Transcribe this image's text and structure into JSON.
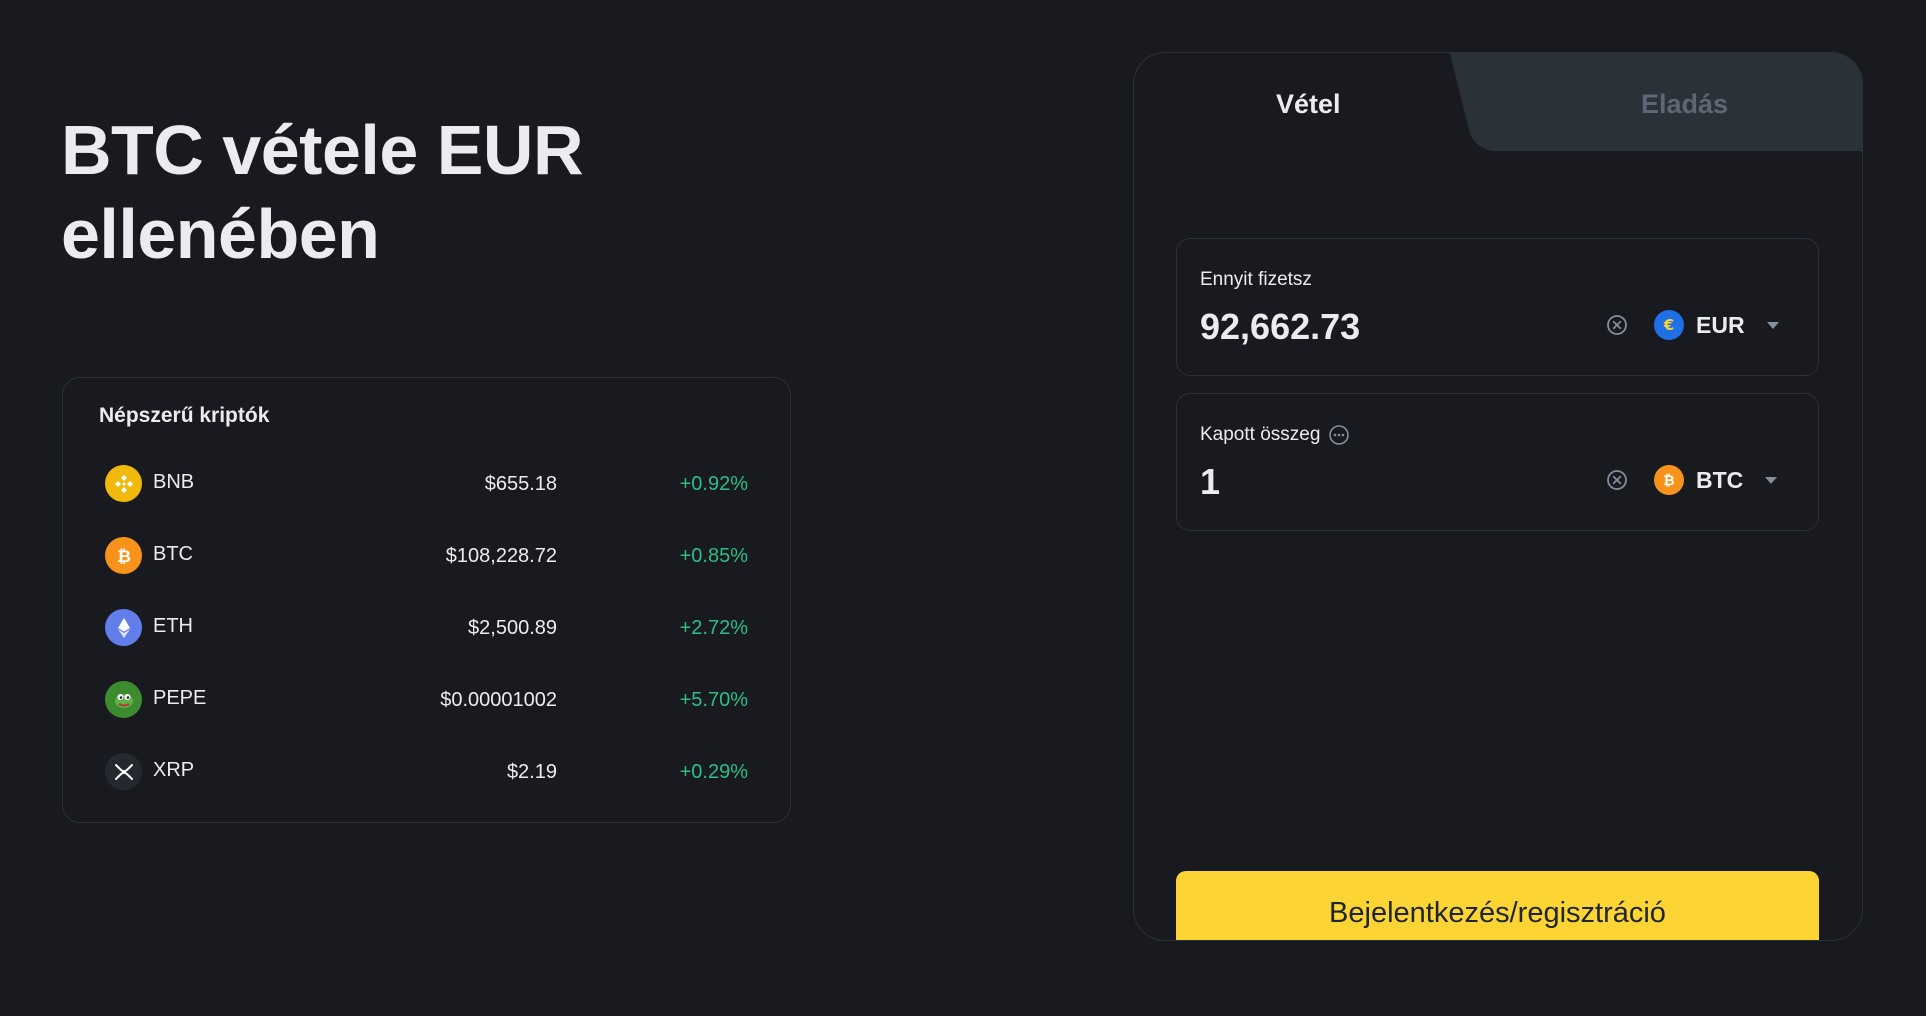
{
  "hero": {
    "title_line1": "BTC vétele EUR",
    "title_line2": "ellenében"
  },
  "popular": {
    "title": "Népszerű kriptók",
    "coins": [
      {
        "symbol": "BNB",
        "price": "$655.18",
        "change": "+0.92%",
        "icon": "bnb-icon",
        "color": "#f0b90b"
      },
      {
        "symbol": "BTC",
        "price": "$108,228.72",
        "change": "+0.85%",
        "icon": "btc-icon",
        "color": "#f7931a"
      },
      {
        "symbol": "ETH",
        "price": "$2,500.89",
        "change": "+2.72%",
        "icon": "eth-icon",
        "color": "#627eea"
      },
      {
        "symbol": "PEPE",
        "price": "$0.00001002",
        "change": "+5.70%",
        "icon": "pepe-icon",
        "color": "#3d8b2f"
      },
      {
        "symbol": "XRP",
        "price": "$2.19",
        "change": "+0.29%",
        "icon": "xrp-icon",
        "color": "#23292f"
      }
    ]
  },
  "trade": {
    "tabs": {
      "buy": "Vétel",
      "sell": "Eladás",
      "active": "buy"
    },
    "pay": {
      "label": "Ennyit fizetsz",
      "value": "92,662.73",
      "currency": "EUR",
      "currency_icon": "euro-icon"
    },
    "receive": {
      "label": "Kapott összeg",
      "value": "1",
      "currency": "BTC",
      "currency_icon": "btc-icon"
    },
    "login_button": "Bejelentkezés/regisztráció"
  },
  "colors": {
    "background": "#181a20",
    "border": "#2b3139",
    "positive": "#2ebd85",
    "accent": "#fcd535",
    "muted_tab": "#5e6673"
  }
}
